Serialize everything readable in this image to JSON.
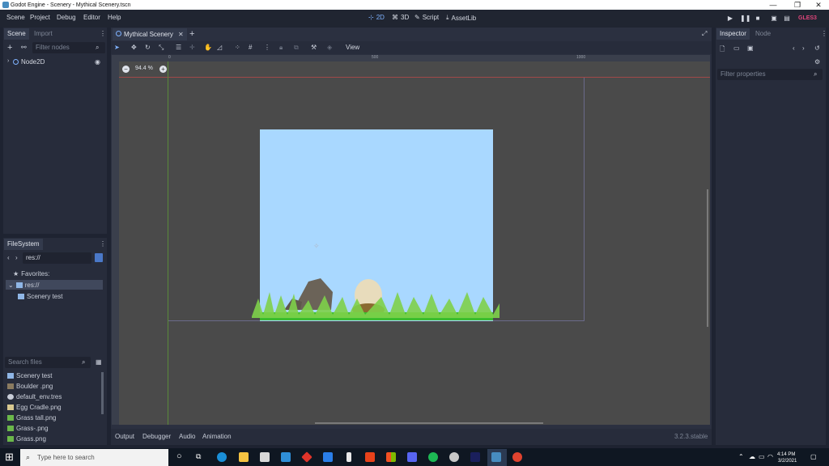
{
  "window": {
    "title": "Godot Engine - Scenery - Mythical Scenery.tscn",
    "minimize": "—",
    "maximize": "❐",
    "close": "✕"
  },
  "menubar": {
    "items": [
      "Scene",
      "Project",
      "Debug",
      "Editor",
      "Help"
    ]
  },
  "modes": {
    "twod": "2D",
    "threed": "3D",
    "script": "Script",
    "assetlib": "AssetLib"
  },
  "renderer": "GLES3",
  "scene_dock": {
    "tabs": [
      "Scene",
      "Import"
    ],
    "filter_placeholder": "Filter nodes",
    "root_node": "Node2D"
  },
  "filesystem": {
    "tab": "FileSystem",
    "path": "res://",
    "favorites": "Favorites:",
    "tree": [
      "res://",
      "Scenery test"
    ],
    "search_placeholder": "Search files",
    "files": [
      "Scenery test",
      "Boulder .png",
      "default_env.tres",
      "Egg Cradle.png",
      "Grass tall.png",
      "Grass-.png",
      "Grass.png"
    ]
  },
  "editor": {
    "scene_tab": "Mythical Scenery",
    "view_menu": "View",
    "zoom": "94.4 %",
    "ruler_marks": [
      "0",
      "500",
      "1000"
    ],
    "bottom_tabs": [
      "Output",
      "Debugger",
      "Audio",
      "Animation"
    ],
    "version": "3.2.3.stable"
  },
  "inspector": {
    "tabs": [
      "Inspector",
      "Node"
    ],
    "filter_placeholder": "Filter properties"
  },
  "taskbar": {
    "search_placeholder": "Type here to search",
    "time": "4:14 PM",
    "date": "3/2/2021"
  },
  "colors": {
    "sky": "#a9d8ff",
    "accent": "#7fb2ff",
    "renderer": "#e0457b"
  }
}
